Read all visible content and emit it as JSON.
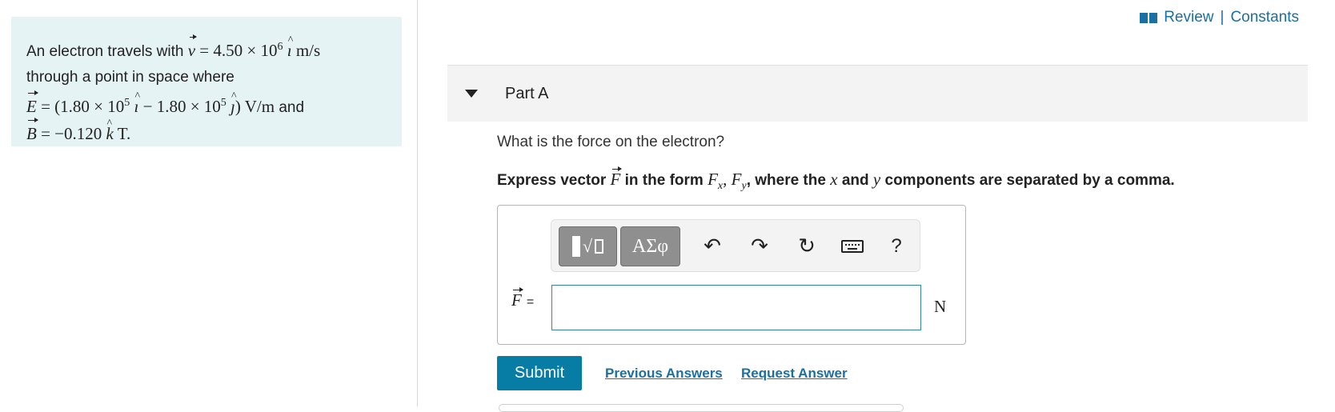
{
  "problem": {
    "line1_prefix": "An electron travels with",
    "line1_math_v": "v",
    "line1_math_rest": "= 4.50 × 10",
    "line1_exp": "6",
    "line1_unit_vec": "ı",
    "line1_units": "m/s",
    "line2": "through a point in space where",
    "line3_E": "E",
    "line3_math": "= (1.80 × 10",
    "line3_exp1": "5",
    "line3_i": "ı",
    "line3_mid": "− 1.80 × 10",
    "line3_exp2": "5",
    "line3_j": "ȷ",
    "line3_units": ") V/m",
    "line3_and": "and",
    "line4_B": "B",
    "line4_math": "= −0.120",
    "line4_k": "k",
    "line4_units": "T."
  },
  "header": {
    "review": "Review",
    "separator": "|",
    "constants": "Constants"
  },
  "part": {
    "title": "Part A",
    "question": "What is the force on the electron?",
    "instruction_a": "Express vector",
    "instruction_F": "F",
    "instruction_b": "in the form",
    "instruction_Fx": "F",
    "instruction_x_sub": "x",
    "instruction_comma": ",",
    "instruction_Fy": "F",
    "instruction_y_sub": "y",
    "instruction_c": ", where the",
    "instruction_x": "x",
    "instruction_d": "and",
    "instruction_y": "y",
    "instruction_e": "components are separated by a comma."
  },
  "toolbar": {
    "templates_sqrt": "√",
    "symbols_label": "ΑΣφ",
    "undo": "↶",
    "redo": "↷",
    "reset": "↻",
    "help": "?"
  },
  "answer": {
    "var": "F",
    "equals": "=",
    "value": "",
    "unit": "N"
  },
  "actions": {
    "submit": "Submit",
    "previous_answers": "Previous Answers",
    "request_answer": "Request Answer"
  },
  "colors": {
    "panel_bg": "#e6f3f4",
    "link": "#1a6fa3",
    "submit_bg": "#077da6",
    "input_border": "#2e86a0"
  }
}
